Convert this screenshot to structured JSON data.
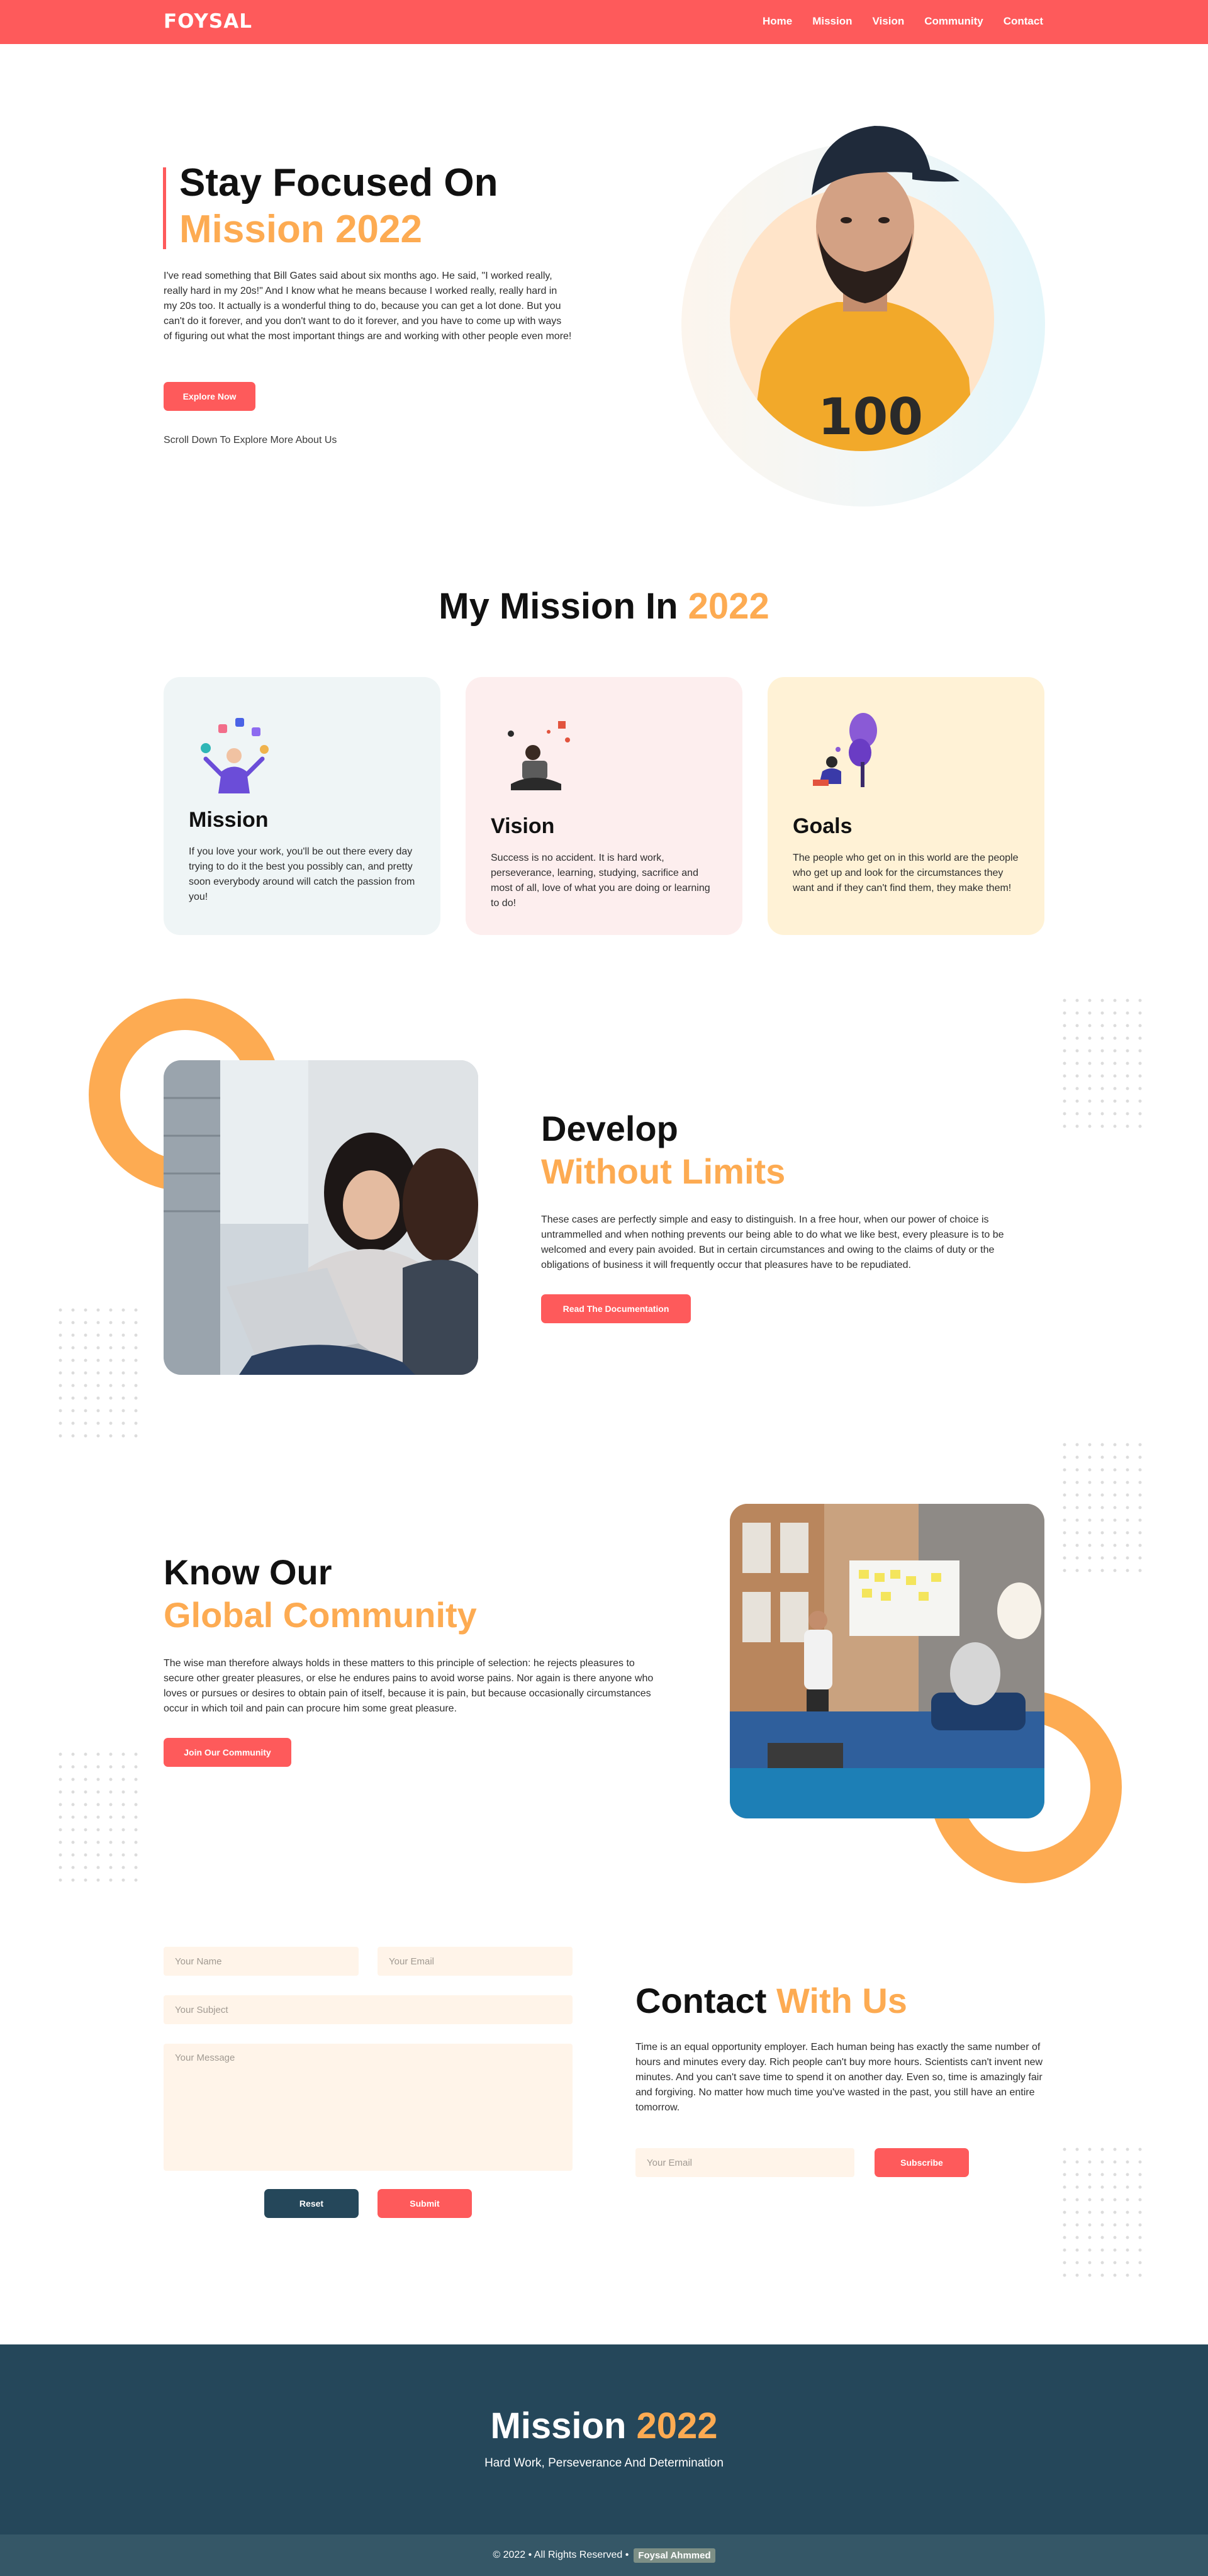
{
  "nav": {
    "logo": "FOYSAL",
    "links": [
      "Home",
      "Mission",
      "Vision",
      "Community",
      "Contact"
    ]
  },
  "hero": {
    "title_line1": "Stay Focused On",
    "title_line2": "Mission 2022",
    "paragraph": "I've read something that Bill Gates said about six months ago. He said, \"I worked really, really hard in my 20s!\" And I know what he means because I worked really, really hard in my 20s too. It actually is a wonderful thing to do, because you can get a lot done. But you can't do it forever, and you don't want to do it forever, and you have to come up with ways of figuring out what the most important things are and working with other people even more!",
    "button": "Explore Now",
    "scroll_text": "Scroll Down To Explore More About Us"
  },
  "mission": {
    "title_main": "My Mission In",
    "title_accent": "2022",
    "cards": [
      {
        "title": "Mission",
        "text": "If you love your work, you'll be out there every day trying to do it the best you possibly can, and pretty soon everybody around will catch the passion from you!"
      },
      {
        "title": "Vision",
        "text": "Success is no accident. It is hard work, perseverance, learning, studying, sacrifice and most of all, love of what you are doing or learning to do!"
      },
      {
        "title": "Goals",
        "text": "The people who get on in this world are the people who get up and look for the circumstances they want and if they can't find them, they make them!"
      }
    ]
  },
  "develop": {
    "title_main": "Develop",
    "title_accent": "Without Limits",
    "paragraph": "These cases are perfectly simple and easy to distinguish. In a free hour, when our power of choice is untrammelled and when nothing prevents our being able to do what we like best, every pleasure is to be welcomed and every pain avoided. But in certain circumstances and owing to the claims of duty or the obligations of business it will frequently occur that pleasures have to be repudiated.",
    "button": "Read The Documentation"
  },
  "community": {
    "title_main": "Know Our",
    "title_accent": "Global Community",
    "paragraph": "The wise man therefore always holds in these matters to this principle of selection: he rejects pleasures to secure other greater pleasures, or else he endures pains to avoid worse pains. Nor again is there anyone who loves or pursues or desires to obtain pain of itself, because it is pain, but because occasionally circumstances occur in which toil and pain can procure him some great pleasure.",
    "button": "Join Our Community"
  },
  "contact": {
    "form": {
      "name_placeholder": "Your Name",
      "email_placeholder": "Your Email",
      "subject_placeholder": "Your Subject",
      "message_placeholder": "Your Message",
      "reset": "Reset",
      "submit": "Submit"
    },
    "title_main": "Contact",
    "title_accent": "With Us",
    "paragraph": "Time is an equal opportunity employer. Each human being has exactly the same number of hours and minutes every day. Rich people can't buy more hours. Scientists can't invent new minutes. And you can't save time to spend it on another day. Even so, time is amazingly fair and forgiving. No matter how much time you've wasted in the past, you still have an entire tomorrow.",
    "subscribe_placeholder": "Your Email",
    "subscribe_button": "Subscribe"
  },
  "footer": {
    "title_main": "Mission",
    "title_accent": "2022",
    "tagline": "Hard Work, Perseverance And Determination",
    "copyright": "© 2022 • All Rights Reserved •",
    "author": "Foysal Ahmmed"
  },
  "colors": {
    "brand_red": "#fe5a5b",
    "accent_orange": "#fdab52",
    "dark_teal": "#25475a"
  }
}
